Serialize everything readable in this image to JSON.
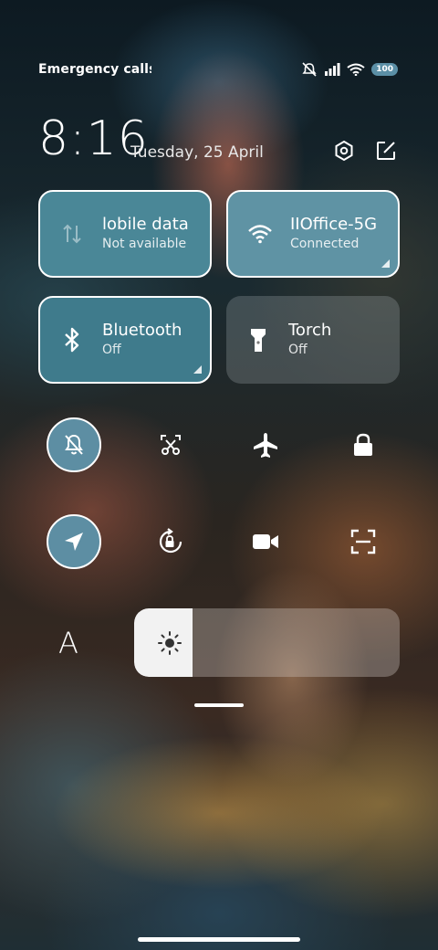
{
  "status_bar": {
    "carrier_text": "Emergency calls o",
    "battery": "100",
    "icons": [
      "mute-icon",
      "signal-icon",
      "wifi-icon",
      "battery-icon"
    ]
  },
  "header": {
    "time": "8:16",
    "date": "Tuesday, 25 April",
    "icons": [
      "settings-icon",
      "edit-icon"
    ]
  },
  "tiles": {
    "mobile_data": {
      "title": "lobile data",
      "subtitle": "Not available",
      "icon": "mobile-data-icon"
    },
    "wifi": {
      "title": "IIOffice-5G",
      "subtitle": "Connected",
      "icon": "wifi-icon"
    },
    "bluetooth": {
      "title": "Bluetooth",
      "subtitle": "Off",
      "icon": "bluetooth-icon"
    },
    "torch": {
      "title": "Torch",
      "subtitle": "Off",
      "icon": "torch-icon"
    }
  },
  "toggles": [
    {
      "name": "mute",
      "icon": "bell-off-icon",
      "active": true
    },
    {
      "name": "screenshot",
      "icon": "scissors-icon",
      "active": false
    },
    {
      "name": "airplane",
      "icon": "airplane-icon",
      "active": false
    },
    {
      "name": "lock",
      "icon": "lock-icon",
      "active": false
    },
    {
      "name": "location",
      "icon": "location-icon",
      "active": true
    },
    {
      "name": "rotation-lock",
      "icon": "rotation-lock-icon",
      "active": false
    },
    {
      "name": "screen-record",
      "icon": "video-icon",
      "active": false
    },
    {
      "name": "scanner",
      "icon": "scan-icon",
      "active": false
    }
  ],
  "brightness": {
    "font_size_label": "A",
    "level": 0.22
  },
  "colors": {
    "active_accent": "#5d8ea3",
    "tile_active_bg": "#4c8596",
    "tile_inactive_bg": "rgba(200,210,215,0.28)"
  }
}
